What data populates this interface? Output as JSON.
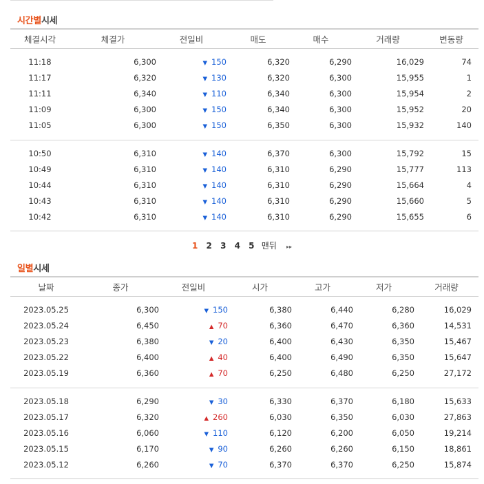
{
  "time_section": {
    "title_accent": "시간별",
    "title_rest": "시세",
    "columns": [
      "체결시각",
      "체결가",
      "전일비",
      "매도",
      "매수",
      "거래량",
      "변동량"
    ],
    "group1": [
      {
        "time": "11:18",
        "price": "6,300",
        "change": "150",
        "dir": "down",
        "ask": "6,320",
        "bid": "6,290",
        "volume": "16,029",
        "delta": "74"
      },
      {
        "time": "11:17",
        "price": "6,320",
        "change": "130",
        "dir": "down",
        "ask": "6,320",
        "bid": "6,300",
        "volume": "15,955",
        "delta": "1"
      },
      {
        "time": "11:11",
        "price": "6,340",
        "change": "110",
        "dir": "down",
        "ask": "6,340",
        "bid": "6,300",
        "volume": "15,954",
        "delta": "2"
      },
      {
        "time": "11:09",
        "price": "6,300",
        "change": "150",
        "dir": "down",
        "ask": "6,340",
        "bid": "6,300",
        "volume": "15,952",
        "delta": "20"
      },
      {
        "time": "11:05",
        "price": "6,300",
        "change": "150",
        "dir": "down",
        "ask": "6,350",
        "bid": "6,300",
        "volume": "15,932",
        "delta": "140"
      }
    ],
    "group2": [
      {
        "time": "10:50",
        "price": "6,310",
        "change": "140",
        "dir": "down",
        "ask": "6,370",
        "bid": "6,300",
        "volume": "15,792",
        "delta": "15"
      },
      {
        "time": "10:49",
        "price": "6,310",
        "change": "140",
        "dir": "down",
        "ask": "6,310",
        "bid": "6,290",
        "volume": "15,777",
        "delta": "113"
      },
      {
        "time": "10:44",
        "price": "6,310",
        "change": "140",
        "dir": "down",
        "ask": "6,310",
        "bid": "6,290",
        "volume": "15,664",
        "delta": "4"
      },
      {
        "time": "10:43",
        "price": "6,310",
        "change": "140",
        "dir": "down",
        "ask": "6,310",
        "bid": "6,290",
        "volume": "15,660",
        "delta": "5"
      },
      {
        "time": "10:42",
        "price": "6,310",
        "change": "140",
        "dir": "down",
        "ask": "6,310",
        "bid": "6,290",
        "volume": "15,655",
        "delta": "6"
      }
    ]
  },
  "pagination": {
    "pages": [
      "1",
      "2",
      "3",
      "4",
      "5"
    ],
    "current": "1",
    "last_label": "맨뒤",
    "next_glyph": "▸▸"
  },
  "day_section": {
    "title_accent": "일별",
    "title_rest": "시세",
    "columns": [
      "날짜",
      "종가",
      "전일비",
      "시가",
      "고가",
      "저가",
      "거래량"
    ],
    "group1": [
      {
        "date": "2023.05.25",
        "close": "6,300",
        "change": "150",
        "dir": "down",
        "open": "6,380",
        "high": "6,440",
        "low": "6,280",
        "volume": "16,029"
      },
      {
        "date": "2023.05.24",
        "close": "6,450",
        "change": "70",
        "dir": "up",
        "open": "6,360",
        "high": "6,470",
        "low": "6,360",
        "volume": "14,531"
      },
      {
        "date": "2023.05.23",
        "close": "6,380",
        "change": "20",
        "dir": "down",
        "open": "6,400",
        "high": "6,430",
        "low": "6,350",
        "volume": "15,467"
      },
      {
        "date": "2023.05.22",
        "close": "6,400",
        "change": "40",
        "dir": "up",
        "open": "6,400",
        "high": "6,490",
        "low": "6,350",
        "volume": "15,647"
      },
      {
        "date": "2023.05.19",
        "close": "6,360",
        "change": "70",
        "dir": "up",
        "open": "6,250",
        "high": "6,480",
        "low": "6,250",
        "volume": "27,172"
      }
    ],
    "group2": [
      {
        "date": "2023.05.18",
        "close": "6,290",
        "change": "30",
        "dir": "down",
        "open": "6,330",
        "high": "6,370",
        "low": "6,180",
        "volume": "15,633"
      },
      {
        "date": "2023.05.17",
        "close": "6,320",
        "change": "260",
        "dir": "up",
        "open": "6,030",
        "high": "6,350",
        "low": "6,030",
        "volume": "27,863"
      },
      {
        "date": "2023.05.16",
        "close": "6,060",
        "change": "110",
        "dir": "down",
        "open": "6,120",
        "high": "6,200",
        "low": "6,050",
        "volume": "19,214"
      },
      {
        "date": "2023.05.15",
        "close": "6,170",
        "change": "90",
        "dir": "down",
        "open": "6,260",
        "high": "6,260",
        "low": "6,150",
        "volume": "18,861"
      },
      {
        "date": "2023.05.12",
        "close": "6,260",
        "change": "70",
        "dir": "down",
        "open": "6,370",
        "high": "6,370",
        "low": "6,250",
        "volume": "15,874"
      }
    ]
  },
  "glyphs": {
    "down": "▼",
    "up": "▲"
  },
  "colors": {
    "accent": "#e8531c",
    "down": "#1a60d8",
    "up": "#d42a2a"
  }
}
